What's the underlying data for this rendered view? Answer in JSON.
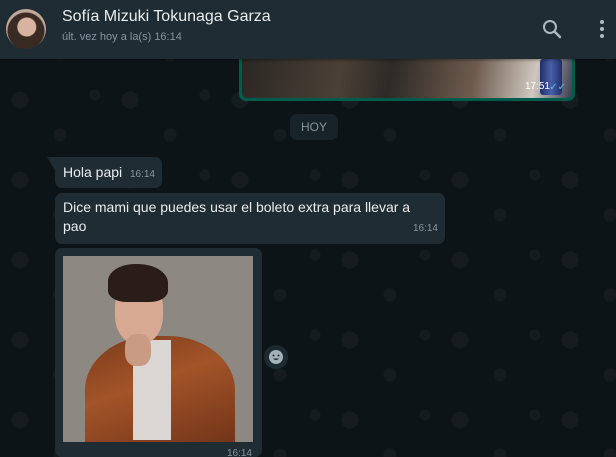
{
  "header": {
    "contact_name": "Sofía Mizuki Tokunaga Garza",
    "last_seen": "últ. vez hoy a la(s) 16:14",
    "icons": [
      "search-icon",
      "menu-icon"
    ]
  },
  "colors": {
    "header_bg": "#1f2c33",
    "chat_bg": "#0d1418",
    "incoming_bubble": "#202c33",
    "outgoing_bubble": "#005c4b",
    "read_tick": "#53bdeb"
  },
  "messages": {
    "previous_image": {
      "time": "17:51"
    },
    "date_divider": "HOY",
    "items": [
      {
        "text": "Hola papi",
        "time": "16:14"
      },
      {
        "text": "Dice mami que puedes usar el boleto extra para llevar a pao",
        "time": "16:14"
      }
    ],
    "image_message": {
      "time": "16:14"
    }
  }
}
